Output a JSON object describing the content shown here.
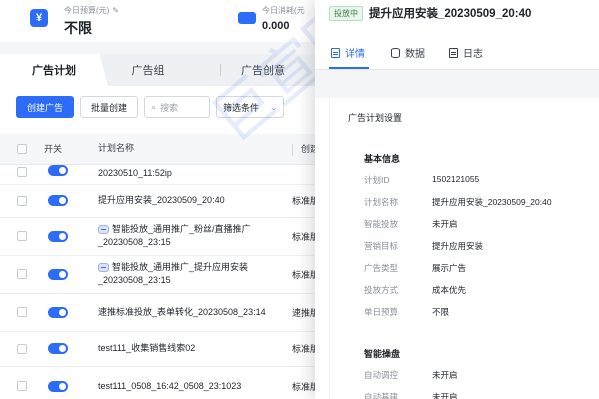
{
  "budget": {
    "today_budget_label": "今日预算(元)",
    "today_budget_value": "不限",
    "today_spend_label": "今日消耗(元",
    "today_spend_value": "0.000",
    "budget_icon": "yen-icon",
    "spend_icon": "wallet-icon"
  },
  "tabs": [
    "广告计划",
    "广告组",
    "广告创意"
  ],
  "toolbar": {
    "create": "创建广告",
    "batch_create": "批量创建",
    "search_placeholder": "搜索",
    "filter": "筛选条件"
  },
  "table": {
    "headers": {
      "switch": "开关",
      "name": "计划名称",
      "type": "创建链"
    },
    "rows": [
      {
        "name": "20230510_11:52ip",
        "type": ""
      },
      {
        "name": "提升应用安装_20230509_20:40",
        "type": "标准版"
      },
      {
        "name": "智能投放_通用推广_粉丝/直播推广_20230508_23:15",
        "type": "标准版",
        "robot": true
      },
      {
        "name": "智能投放_通用推广_提升应用安装_20230508_23:15",
        "type": "标准版",
        "robot": true
      },
      {
        "name": "速推标准投放_表单转化_20230508_23:14",
        "type": "速推版"
      },
      {
        "name": "test111_收集销售线索02",
        "type": "标准版"
      },
      {
        "name": "test111_0508_16:42_0508_23:1023",
        "type": "标准版"
      }
    ]
  },
  "watermark": "巨宣网络",
  "drawer": {
    "status": "投放中",
    "title": "提升应用安装_20230509_20:40",
    "tabs": [
      "详情",
      "数据",
      "日志"
    ],
    "section_title": "广告计划设置",
    "basic_info_title": "基本信息",
    "basic_info": [
      {
        "k": "计划ID",
        "v": "1502121055"
      },
      {
        "k": "计划名称",
        "v": "提升应用安装_20230509_20:40"
      },
      {
        "k": "智能投放",
        "v": "未开启"
      },
      {
        "k": "营销目标",
        "v": "提升应用安装"
      },
      {
        "k": "广告类型",
        "v": "展示广告"
      },
      {
        "k": "投放方式",
        "v": "成本优先"
      },
      {
        "k": "单日预算",
        "v": "不限"
      }
    ],
    "smart_title": "智能操盘",
    "smart": [
      {
        "k": "自动调控",
        "v": "未开启"
      },
      {
        "k": "自动基建",
        "v": "未开启"
      }
    ]
  },
  "colors": {
    "accent": "#2d6cf6",
    "status_green": "#3a7c4c"
  }
}
